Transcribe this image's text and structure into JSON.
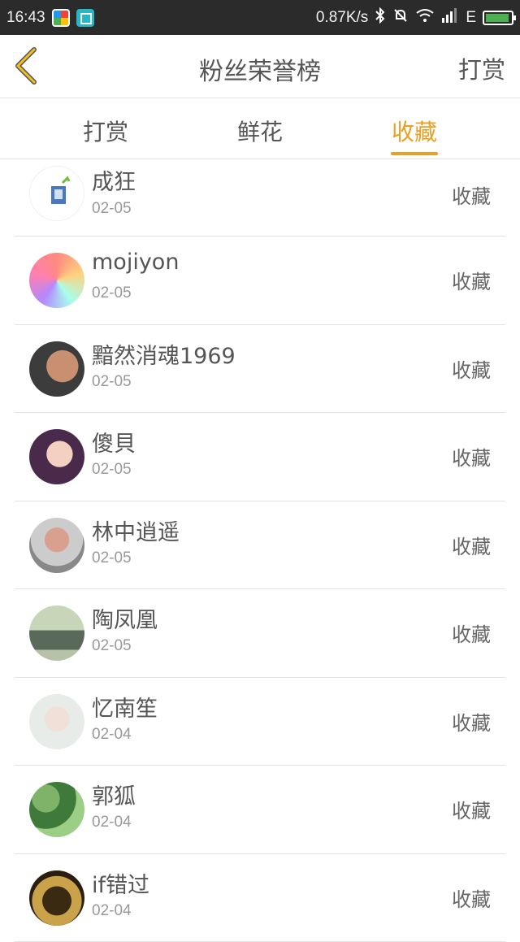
{
  "status_bar": {
    "time": "16:43",
    "speed": "0.87K/s",
    "network": "E"
  },
  "nav": {
    "title": "粉丝荣誉榜",
    "action": "打赏"
  },
  "tabs": [
    {
      "label": "打赏"
    },
    {
      "label": "鲜花"
    },
    {
      "label": "收藏"
    }
  ],
  "colors": {
    "accent": "#e8a020",
    "text": "#555555",
    "subtext": "#999999",
    "divider": "#e2e2e2"
  },
  "list": [
    {
      "name": "成狂",
      "date": "02-05",
      "action": "收藏"
    },
    {
      "name": "mojiyon",
      "date": "02-05",
      "action": "收藏"
    },
    {
      "name": "黯然消魂1969",
      "date": "02-05",
      "action": "收藏"
    },
    {
      "name": "傻貝",
      "date": "02-05",
      "action": "收藏"
    },
    {
      "name": "林中逍遥",
      "date": "02-05",
      "action": "收藏"
    },
    {
      "name": "陶凤凰",
      "date": "02-05",
      "action": "收藏"
    },
    {
      "name": "忆南笙",
      "date": "02-04",
      "action": "收藏"
    },
    {
      "name": "郭狐",
      "date": "02-04",
      "action": "收藏"
    },
    {
      "name": "if错过",
      "date": "02-04",
      "action": "收藏"
    }
  ]
}
